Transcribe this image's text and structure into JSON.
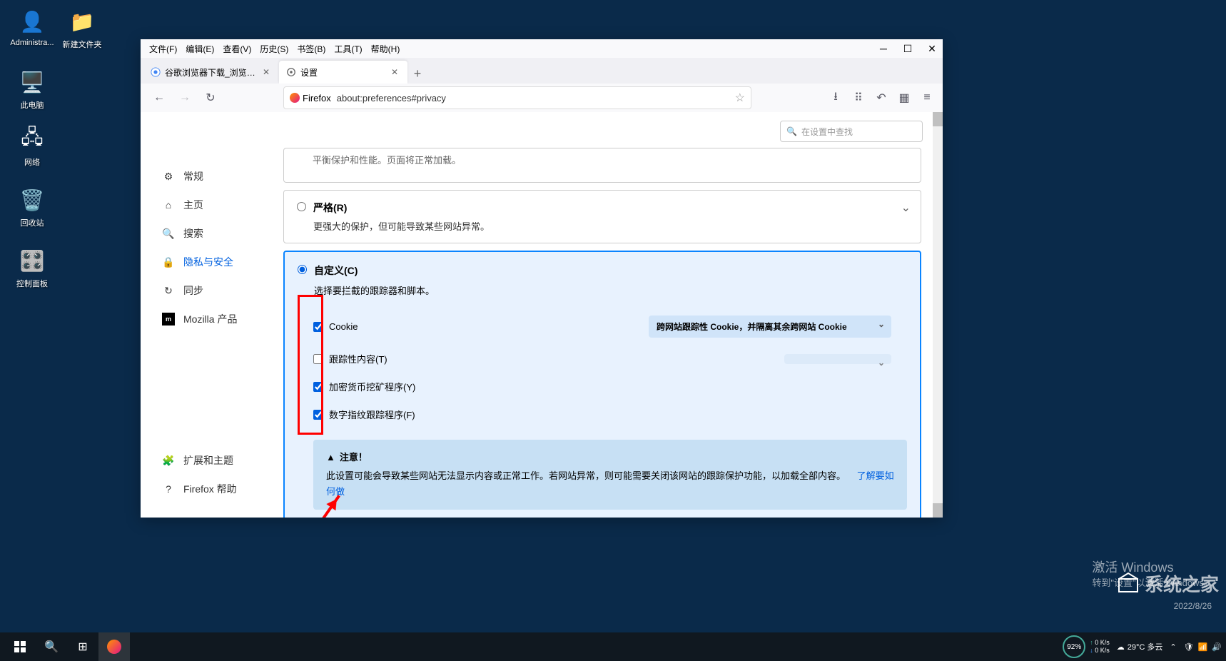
{
  "desktop": {
    "icons": [
      {
        "label": "Administra...",
        "glyph": "👤"
      },
      {
        "label": "新建文件夹",
        "glyph": "📁"
      },
      {
        "label": "此电脑",
        "glyph": "🖥️"
      },
      {
        "label": "网络",
        "glyph": "🖧"
      },
      {
        "label": "回收站",
        "glyph": "🗑️"
      },
      {
        "label": "控制面板",
        "glyph": "⚙️"
      }
    ]
  },
  "window": {
    "menus": [
      "文件(F)",
      "编辑(E)",
      "查看(V)",
      "历史(S)",
      "书签(B)",
      "工具(T)",
      "帮助(H)"
    ],
    "tabs": [
      {
        "title": "谷歌浏览器下载_浏览器官网入口",
        "active": false
      },
      {
        "title": "设置",
        "active": true
      }
    ],
    "url_identity": "Firefox",
    "url": "about:preferences#privacy"
  },
  "settings": {
    "search_placeholder": "在设置中查找",
    "sidebar": [
      {
        "icon": "gear",
        "label": "常规"
      },
      {
        "icon": "home",
        "label": "主页"
      },
      {
        "icon": "search",
        "label": "搜索"
      },
      {
        "icon": "lock",
        "label": "隐私与安全",
        "active": true
      },
      {
        "icon": "sync",
        "label": "同步"
      },
      {
        "icon": "moz",
        "label": "Mozilla 产品"
      }
    ],
    "sidebar_bottom": [
      {
        "icon": "puzzle",
        "label": "扩展和主题"
      },
      {
        "icon": "help",
        "label": "Firefox 帮助"
      }
    ],
    "truncated_line": "平衡保护和性能。页面将正常加载。",
    "strict": {
      "title": "严格(R)",
      "desc": "更强大的保护，但可能导致某些网站异常。"
    },
    "custom": {
      "title": "自定义(C)",
      "desc": "选择要拦截的跟踪器和脚本。",
      "checks": [
        {
          "label": "Cookie",
          "checked": true,
          "dropdown": "跨网站跟踪性 Cookie，并隔离其余跨网站 Cookie"
        },
        {
          "label": "跟踪性内容(T)",
          "checked": false,
          "dropdown": ""
        },
        {
          "label": "加密货币挖矿程序(Y)",
          "checked": true
        },
        {
          "label": "数字指纹跟踪程序(F)",
          "checked": true
        }
      ]
    },
    "notice": {
      "title": "注意！",
      "body": "此设置可能会导致某些网站无法显示内容或正常工作。若网站异常，则可能需要关闭该网站的跟踪保护功能，以加载全部内容。",
      "link": "了解要如何做"
    }
  },
  "overlay": {
    "activate_title": "激活 Windows",
    "activate_sub": "转到\"设置\"以激活 Windows。",
    "watermark": "系统之家",
    "date": "2022/8/26"
  },
  "taskbar": {
    "battery": "92%",
    "net_up": "0 K/s",
    "net_dn": "0 K/s",
    "weather": "29°C 多云"
  }
}
